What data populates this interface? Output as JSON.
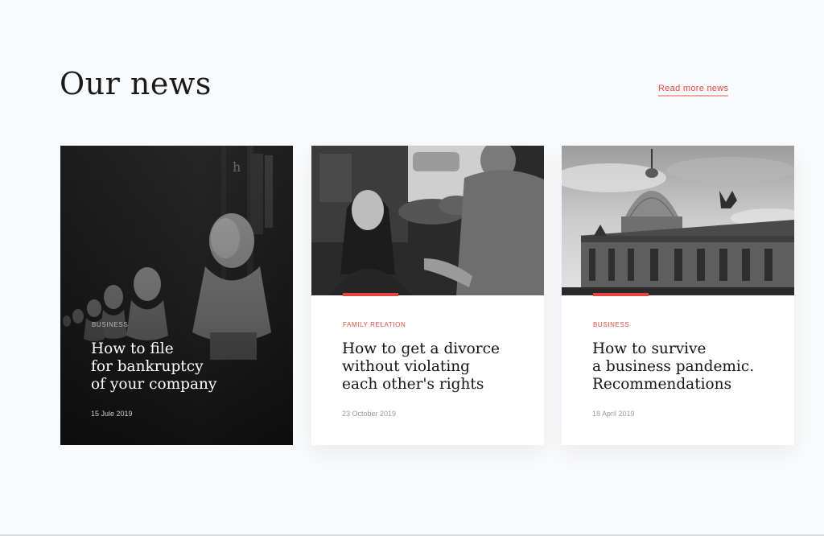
{
  "section": {
    "title": "Our news",
    "read_more": "Read more news"
  },
  "colors": {
    "accent": "#e2483d",
    "background": "#f9fafb",
    "dark_card": "#222222"
  },
  "cards": [
    {
      "category": "BUSINESS",
      "headline": "How to file\nfor bankruptcy\nof your company",
      "date": "15 Jule 2019",
      "image": "busts-statues-photo"
    },
    {
      "category": "FAMILY RELATION",
      "headline": "How to get a divorce\nwithout violating\neach other's rights",
      "date": "23 October 2019",
      "image": "couple-photo"
    },
    {
      "category": "BUSINESS",
      "headline": "How to survive\na business pandemic.\nRecommendations",
      "date": "18 April 2019",
      "image": "dome-building-photo"
    }
  ]
}
